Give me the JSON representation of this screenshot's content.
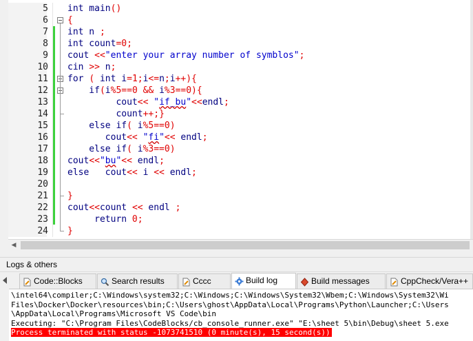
{
  "editor": {
    "lines": [
      {
        "no": "5",
        "code": [
          [
            "kw_id",
            "int main"
          ],
          [
            "op",
            "()"
          ]
        ]
      },
      {
        "no": "6",
        "code": [
          [
            "op",
            "{"
          ]
        ]
      },
      {
        "no": "7",
        "code": [
          [
            "id",
            "int n "
          ],
          [
            "op",
            ";"
          ]
        ]
      },
      {
        "no": "8",
        "code": [
          [
            "id",
            "int count"
          ],
          [
            "op",
            "="
          ],
          [
            "num",
            "0"
          ],
          [
            "op",
            ";"
          ]
        ]
      },
      {
        "no": "9",
        "code": [
          [
            "id",
            "cout "
          ],
          [
            "op",
            "<<"
          ],
          [
            "str",
            "\"enter your array number of symblos\""
          ],
          [
            "op",
            ";"
          ]
        ]
      },
      {
        "no": "10",
        "code": [
          [
            "id",
            "cin "
          ],
          [
            "op",
            ">>"
          ],
          [
            "id",
            " n"
          ],
          [
            "op",
            ";"
          ]
        ]
      },
      {
        "no": "11",
        "code": [
          [
            "id",
            "for "
          ],
          [
            "op",
            "( "
          ],
          [
            "id",
            "int i"
          ],
          [
            "op",
            "="
          ],
          [
            "num",
            "1"
          ],
          [
            "op",
            ";"
          ],
          [
            "id",
            "i"
          ],
          [
            "op",
            "<="
          ],
          [
            "id",
            "n"
          ],
          [
            "op",
            ";"
          ],
          [
            "id",
            "i"
          ],
          [
            "op",
            "++){"
          ]
        ]
      },
      {
        "no": "12",
        "code": [
          [
            "id",
            "    if"
          ],
          [
            "op",
            "("
          ],
          [
            "id",
            "i"
          ],
          [
            "op",
            "%"
          ],
          [
            "num",
            "5"
          ],
          [
            "op",
            "=="
          ],
          [
            "num",
            "0"
          ],
          [
            "op",
            " && "
          ],
          [
            "id",
            "i"
          ],
          [
            "op",
            "%"
          ],
          [
            "num",
            "3"
          ],
          [
            "op",
            "=="
          ],
          [
            "num",
            "0"
          ],
          [
            "op",
            "){"
          ]
        ]
      },
      {
        "no": "13",
        "code": [
          [
            "id",
            "         cout"
          ],
          [
            "op",
            "<< "
          ],
          [
            "str",
            "\"if_bu\""
          ],
          [
            "op",
            "<<"
          ],
          [
            "id",
            "endl"
          ],
          [
            "op",
            ";"
          ]
        ]
      },
      {
        "no": "14",
        "code": [
          [
            "id",
            "         count"
          ],
          [
            "op",
            "++;"
          ],
          [
            "op",
            "}"
          ]
        ]
      },
      {
        "no": "15",
        "code": [
          [
            "id",
            "    else if"
          ],
          [
            "op",
            "( "
          ],
          [
            "id",
            "i"
          ],
          [
            "op",
            "%"
          ],
          [
            "num",
            "5"
          ],
          [
            "op",
            "=="
          ],
          [
            "num",
            "0"
          ],
          [
            "op",
            ")"
          ]
        ]
      },
      {
        "no": "16",
        "code": [
          [
            "id",
            "       cout"
          ],
          [
            "op",
            "<< "
          ],
          [
            "str",
            "\"fi\""
          ],
          [
            "op",
            "<< "
          ],
          [
            "id",
            "endl"
          ],
          [
            "op",
            ";"
          ]
        ]
      },
      {
        "no": "17",
        "code": [
          [
            "id",
            "    else if"
          ],
          [
            "op",
            "( "
          ],
          [
            "id",
            "i"
          ],
          [
            "op",
            "%"
          ],
          [
            "num",
            "3"
          ],
          [
            "op",
            "=="
          ],
          [
            "num",
            "0"
          ],
          [
            "op",
            ")"
          ]
        ]
      },
      {
        "no": "18",
        "code": [
          [
            "id",
            "cout"
          ],
          [
            "op",
            "<<"
          ],
          [
            "str",
            "\"bu\""
          ],
          [
            "op",
            "<< "
          ],
          [
            "id",
            "endl"
          ],
          [
            "op",
            ";"
          ]
        ]
      },
      {
        "no": "19",
        "code": [
          [
            "id",
            "else   cout"
          ],
          [
            "op",
            "<< "
          ],
          [
            "id",
            "i "
          ],
          [
            "op",
            "<< "
          ],
          [
            "id",
            "endl"
          ],
          [
            "op",
            ";"
          ]
        ]
      },
      {
        "no": "20",
        "code": []
      },
      {
        "no": "21",
        "code": [
          [
            "op",
            "}"
          ]
        ]
      },
      {
        "no": "22",
        "code": [
          [
            "id",
            "cout"
          ],
          [
            "op",
            "<<"
          ],
          [
            "id",
            "count "
          ],
          [
            "op",
            "<< "
          ],
          [
            "id",
            "endl "
          ],
          [
            "op",
            ";"
          ]
        ]
      },
      {
        "no": "23",
        "code": [
          [
            "id",
            "     return "
          ],
          [
            "num",
            "0"
          ],
          [
            "op",
            ";"
          ]
        ]
      },
      {
        "no": "24",
        "code": [
          [
            "op",
            "}"
          ]
        ]
      }
    ],
    "spellcheck_words": [
      "bu",
      "fi"
    ]
  },
  "logs_panel": {
    "title": "Logs & others",
    "tabs": [
      {
        "label": "Code::Blocks",
        "icon": "document-icon",
        "active": false
      },
      {
        "label": "Search results",
        "icon": "search-icon",
        "active": false
      },
      {
        "label": "Cccc",
        "icon": "document-icon",
        "active": false
      },
      {
        "label": "Build log",
        "icon": "gear-icon",
        "active": true
      },
      {
        "label": "Build messages",
        "icon": "diamond-icon",
        "active": false
      },
      {
        "label": "CppCheck/Vera++",
        "icon": "document-icon",
        "active": false
      }
    ],
    "log_lines": [
      "\\intel64\\compiler;C:\\Windows\\system32;C:\\Windows;C:\\Windows\\System32\\Wbem;C:\\Windows\\System32\\Wi",
      "Files\\Docker\\Docker\\resources\\bin;C:\\Users\\ghost\\AppData\\Local\\Programs\\Python\\Launcher;C:\\Users",
      "\\AppData\\Local\\Programs\\Microsoft VS Code\\bin",
      "Executing: \"C:\\Program Files\\CodeBlocks/cb_console_runner.exe\" \"E:\\sheet 5\\bin\\Debug\\sheet 5.exe"
    ],
    "status_line": "Process terminated with status -1073741510 (0 minute(s), 15 second(s))"
  },
  "colors": {
    "identifier": "#000080",
    "string": "#0000cc",
    "operator": "#e00000",
    "change_bar": "#3cd13c",
    "error_bg": "#ff0000"
  }
}
